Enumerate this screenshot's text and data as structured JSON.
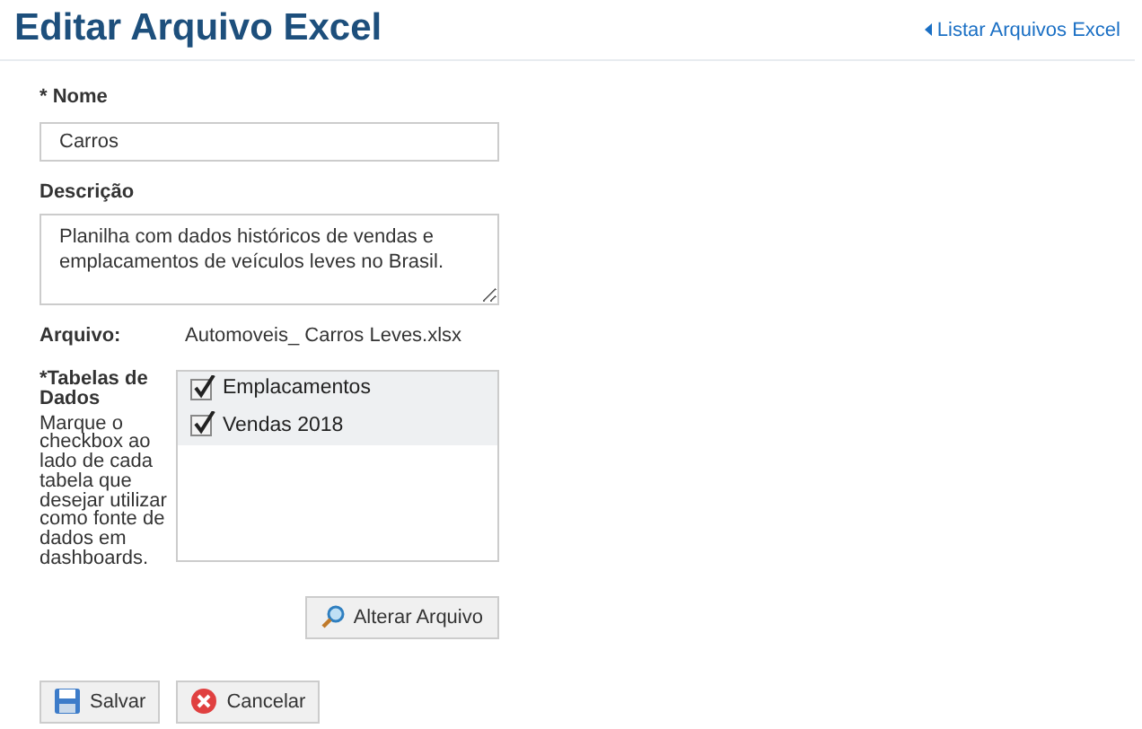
{
  "title": "Editar Arquivo Excel",
  "back_link": {
    "label": "Listar Arquivos Excel"
  },
  "fields": {
    "nome": {
      "label": "* Nome",
      "value": "Carros"
    },
    "descricao": {
      "label": "Descrição",
      "value": "Planilha com dados históricos de vendas e emplacamentos de veículos leves no Brasil."
    },
    "arquivo": {
      "label": "Arquivo:",
      "value": "Automoveis_ Carros Leves.xlsx"
    }
  },
  "tabelas": {
    "label": "*Tabelas de Dados",
    "help": "Marque o checkbox ao lado de cada tabela que desejar utilizar como fonte de dados em dashboards.",
    "items": [
      {
        "label": "Emplacamentos",
        "checked": true
      },
      {
        "label": "Vendas 2018",
        "checked": true
      }
    ]
  },
  "change_button": "Alterar Arquivo",
  "buttons": [
    {
      "kind": "save",
      "label": "Salvar"
    },
    {
      "kind": "cancel",
      "label": "Cancelar"
    }
  ]
}
